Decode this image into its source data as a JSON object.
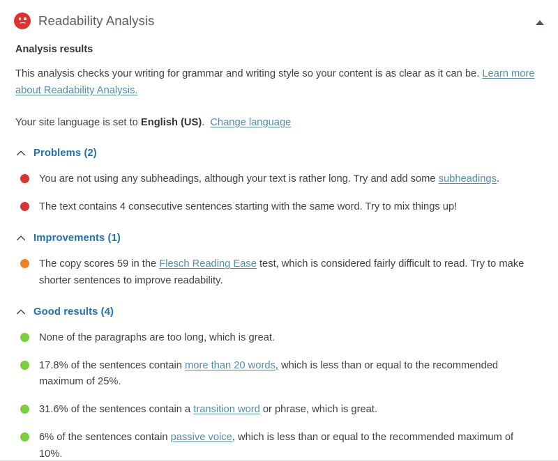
{
  "panel": {
    "title": "Readability Analysis",
    "status_icon": "sad-face-icon",
    "collapse_icon": "caret-up-icon",
    "subtitle": "Analysis results"
  },
  "intro": {
    "text_before_link": "This analysis checks your writing for grammar and writing style so your content is as clear as it can be. ",
    "link_text": "Learn more about Readability Analysis.",
    "link_color": "#4f8ea8"
  },
  "language": {
    "prefix": "Your site language is set to ",
    "value": "English (US)",
    "suffix": ".",
    "change_link": "Change language"
  },
  "sections": [
    {
      "key": "problems",
      "label": "Problems (2)",
      "count": 2,
      "severity": "bad",
      "bullet_color": "#dc3232",
      "chevron_icon": "chevron-up-icon",
      "items": [
        {
          "before": "You are not using any subheadings, although your text is rather long. Try and add some ",
          "link": "subheadings",
          "after": "."
        },
        {
          "before": "The text contains 4 consecutive sentences starting with the same word. Try to mix things up!",
          "link": "",
          "after": ""
        }
      ]
    },
    {
      "key": "improvements",
      "label": "Improvements (1)",
      "count": 1,
      "severity": "ok",
      "bullet_color": "#ee8023",
      "chevron_icon": "chevron-up-icon",
      "items": [
        {
          "before": "The copy scores 59 in the ",
          "link": "Flesch Reading Ease",
          "after": " test, which is considered fairly difficult to read. Try to make shorter sentences to improve readability."
        }
      ]
    },
    {
      "key": "good-results",
      "label": "Good results (4)",
      "count": 4,
      "severity": "good",
      "bullet_color": "#7ad03a",
      "chevron_icon": "chevron-up-icon",
      "items": [
        {
          "before": "None of the paragraphs are too long, which is great.",
          "link": "",
          "after": ""
        },
        {
          "before": "17.8% of the sentences contain ",
          "link": "more than 20 words",
          "after": ", which is less than or equal to the recommended maximum of 25%."
        },
        {
          "before": "31.6% of the sentences contain a ",
          "link": "transition word",
          "after": " or phrase, which is great."
        },
        {
          "before": "6% of the sentences contain ",
          "link": "passive voice",
          "after": ", which is less than or equal to the recommended maximum of 10%."
        }
      ]
    }
  ],
  "colors": {
    "section_heading": "#2271b1",
    "bad": "#dc3232",
    "ok": "#ee8023",
    "good": "#7ad03a",
    "body_text": "#3c434a"
  }
}
